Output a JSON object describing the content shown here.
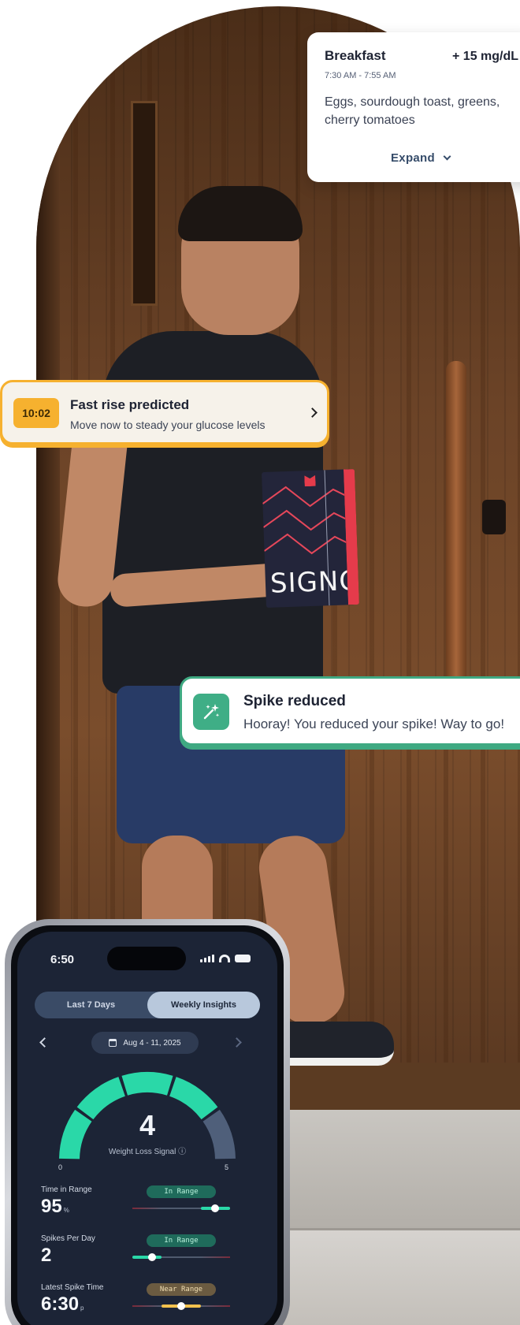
{
  "meal_card": {
    "title": "Breakfast",
    "delta": "+ 15 mg/dL",
    "time": "7:30 AM - 7:55 AM",
    "description": "Eggs, sourdough toast, greens, cherry tomatoes",
    "expand_label": "Expand"
  },
  "rise_card": {
    "time": "10:02",
    "title": "Fast rise predicted",
    "subtitle": "Move now to steady your glucose levels",
    "accent": "#f6b12f"
  },
  "spike_card": {
    "title": "Spike reduced",
    "subtitle": "Hooray! You reduced your spike! Way to go!",
    "accent": "#3fa982"
  },
  "product": {
    "brand": "SIGNOS"
  },
  "phone": {
    "status_time": "6:50",
    "tabs": [
      {
        "label": "Last 7 Days",
        "active": false
      },
      {
        "label": "Weekly Insights",
        "active": true
      }
    ],
    "date_range": "Aug 4 - 11, 2025",
    "gauge": {
      "value": "4",
      "label": "Weight Loss Signal ⓘ",
      "min": "0",
      "max": "5",
      "active_color": "#2ad8a8",
      "inactive_color": "#4f5f7a"
    },
    "metrics": [
      {
        "label": "Time in Range",
        "value": "95",
        "unit": "%",
        "badge": "In Range",
        "tone": "green",
        "level": 0.85
      },
      {
        "label": "Spikes Per Day",
        "value": "2",
        "unit": "",
        "badge": "In Range",
        "tone": "green",
        "level": 0.2
      },
      {
        "label": "Latest Spike Time",
        "value": "6:30",
        "unit": "p",
        "badge": "Near Range",
        "tone": "amber",
        "level": 0.5
      }
    ]
  }
}
